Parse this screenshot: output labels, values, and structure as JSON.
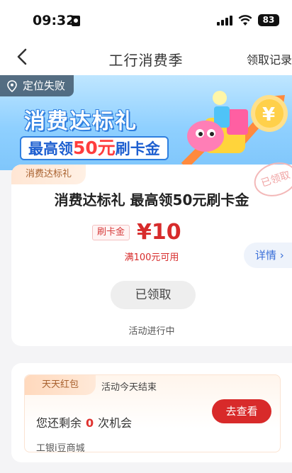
{
  "status_bar": {
    "time": "09:32",
    "battery": "83"
  },
  "nav": {
    "title": "工行消费季",
    "records_link": "领取记录"
  },
  "banner": {
    "location_badge": "定位失败",
    "headline": "消费达标礼",
    "subline_prefix": "最高领",
    "subline_amount": "50元",
    "subline_suffix": "刷卡金"
  },
  "coupon_card": {
    "tag": "消费达标礼",
    "stamp": "已领取",
    "title": "消费达标礼 最高领50元刷卡金",
    "type_pill": "刷卡金",
    "price": "¥10",
    "condition": "满100元可用",
    "details_label": "详情",
    "action_label": "已领取",
    "activity_status": "活动进行中"
  },
  "daily_card": {
    "tag": "天天红包",
    "ends_note": "活动今天结束",
    "remain_prefix": "您还剩余",
    "remain_count": "0",
    "remain_suffix": "次机会",
    "action_label": "去查看",
    "mall_label": "工银i豆商城"
  }
}
